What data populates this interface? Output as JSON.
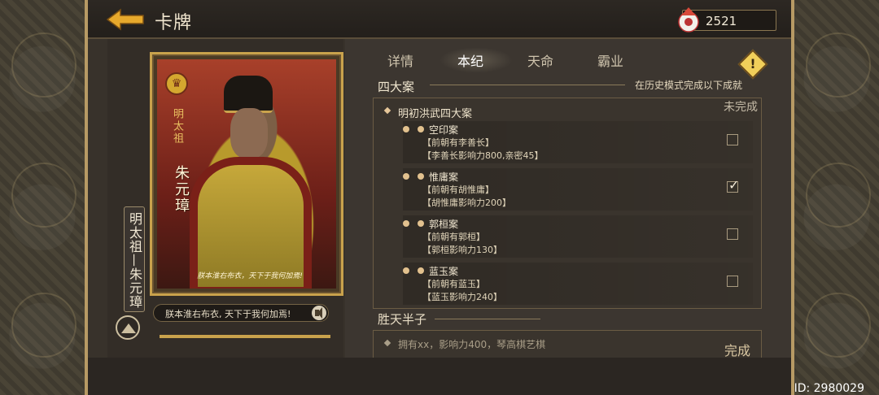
{
  "header": {
    "title": "卡牌",
    "currency_value": "2521"
  },
  "card": {
    "vertical_label": "明太祖",
    "signature": "朱元璋",
    "name_scroll": "明太祖—朱元璋",
    "quote_on_card": "朕本淮右布衣，天下于我何加焉!",
    "quote_bar": "朕本淮右布衣, 天下于我何加焉!"
  },
  "tabs": [
    "详情",
    "本纪",
    "天命",
    "霸业"
  ],
  "active_tab": "本纪",
  "sections": {
    "main_title": "四大案",
    "hint": "在历史模式完成以下成就",
    "group_title": "明初洪武四大案",
    "group_status": "未完成",
    "cases": [
      {
        "name": "空印案",
        "line1": "【前朝有李善长】",
        "line2": "【李善长影响力800,亲密45】",
        "checked": false
      },
      {
        "name": "惟庸案",
        "line1": "【前朝有胡惟庸】",
        "line2": "【胡惟庸影响力200】",
        "checked": true
      },
      {
        "name": "郭桓案",
        "line1": "【前朝有郭桓】",
        "line2": "【郭桓影响力130】",
        "checked": false
      },
      {
        "name": "蓝玉案",
        "line1": "【前朝有蓝玉】",
        "line2": "【蓝玉影响力240】",
        "checked": false
      }
    ],
    "next_title": "胜天半子",
    "next_item": "拥有xx，影响力400，琴高棋艺棋",
    "next_status": "完成"
  },
  "footer": {
    "id_label": "ID: 2980029"
  },
  "colors": {
    "accent_gold": "#c9a24c",
    "warning": "#f1cf5a"
  },
  "icons": {
    "back": "back-arrow-icon",
    "currency": "feather-coin-icon",
    "warning": "warning-icon",
    "sound": "speaker-icon",
    "mountain": "mountain-icon"
  }
}
